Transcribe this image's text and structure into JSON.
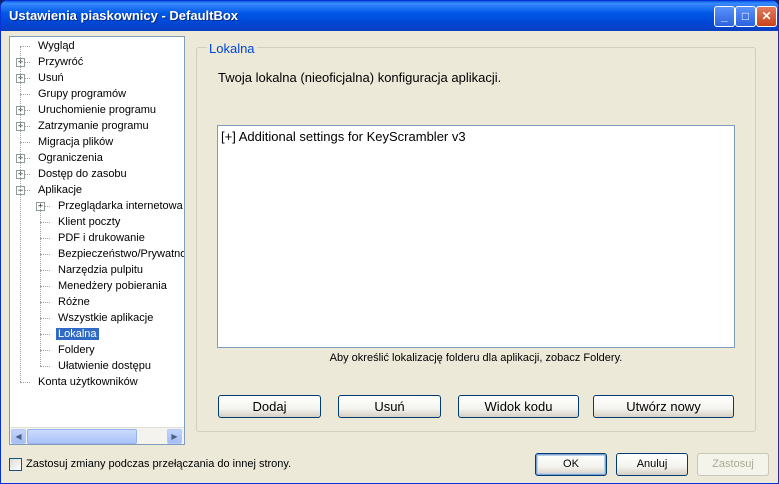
{
  "window": {
    "title": "Ustawienia piaskownicy - DefaultBox",
    "min_glyph": "_",
    "max_glyph": "□",
    "close_glyph": "✕"
  },
  "tree": {
    "items": [
      {
        "label": "Wygląd",
        "level": 0,
        "expander": false
      },
      {
        "label": "Przywróć",
        "level": 0,
        "expander": true
      },
      {
        "label": "Usuń",
        "level": 0,
        "expander": true
      },
      {
        "label": "Grupy programów",
        "level": 0,
        "expander": false
      },
      {
        "label": "Uruchomienie programu",
        "level": 0,
        "expander": true
      },
      {
        "label": "Zatrzymanie programu",
        "level": 0,
        "expander": true
      },
      {
        "label": "Migracja plików",
        "level": 0,
        "expander": false
      },
      {
        "label": "Ograniczenia",
        "level": 0,
        "expander": true
      },
      {
        "label": "Dostęp do zasobu",
        "level": 0,
        "expander": true
      },
      {
        "label": "Aplikacje",
        "level": 0,
        "expander": true,
        "expanded": true
      },
      {
        "label": "Przeglądarka internetowa",
        "level": 1,
        "expander": true
      },
      {
        "label": "Klient poczty",
        "level": 1,
        "expander": false
      },
      {
        "label": "PDF i drukowanie",
        "level": 1,
        "expander": false
      },
      {
        "label": "Bezpieczeństwo/Prywatność",
        "level": 1,
        "expander": false
      },
      {
        "label": "Narzędzia pulpitu",
        "level": 1,
        "expander": false
      },
      {
        "label": "Menedżery pobierania",
        "level": 1,
        "expander": false
      },
      {
        "label": "Różne",
        "level": 1,
        "expander": false
      },
      {
        "label": "Wszystkie aplikacje",
        "level": 1,
        "expander": false
      },
      {
        "label": "Lokalna",
        "level": 1,
        "expander": false,
        "selected": true
      },
      {
        "label": "Foldery",
        "level": 1,
        "expander": false
      },
      {
        "label": "Ułatwienie dostępu",
        "level": 1,
        "expander": false
      },
      {
        "label": "Konta użytkowników",
        "level": 0,
        "expander": false
      }
    ]
  },
  "main": {
    "group_title": "Lokalna",
    "description": "Twoja lokalna (nieoficjalna) konfiguracja aplikacji.",
    "list_entries": [
      "[+]  Additional settings for KeyScrambler v3"
    ],
    "hint": "Aby określić lokalizację folderu dla aplikacji, zobacz Foldery.",
    "buttons": {
      "add": "Dodaj",
      "remove": "Usuń",
      "view_code": "Widok kodu",
      "create_new": "Utwórz nowy"
    }
  },
  "footer": {
    "apply_on_switch": "Zastosuj zmiany podczas przełączania do innej strony.",
    "ok": "OK",
    "cancel": "Anuluj",
    "apply": "Zastosuj"
  },
  "colors": {
    "title_bar": "#0058e6",
    "selection": "#316ac5",
    "group_title": "#0046d5",
    "dialog_bg": "#ece9d8"
  }
}
